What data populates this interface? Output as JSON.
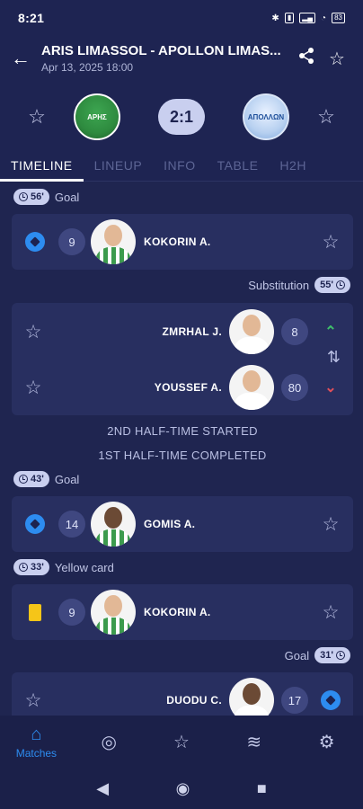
{
  "status": {
    "time": "8:21",
    "icons_text": [
      "bluetooth",
      "vibrate",
      "signal",
      "wifi",
      "battery"
    ],
    "battery": "83"
  },
  "header": {
    "title": "ARIS LIMASSOL - APOLLON LIMAS...",
    "date": "Apr 13, 2025 18:00"
  },
  "match": {
    "score": "2:1",
    "home_crest_text": "ΑΡΗΣ",
    "away_crest_text": "ΑΠΟΛΛΩΝ"
  },
  "tabs": [
    "TIMELINE",
    "LINEUP",
    "INFO",
    "TABLE",
    "H2H"
  ],
  "events": {
    "goal1": {
      "minute": "56'",
      "type": "Goal",
      "number": "9",
      "player": "KOKORIN A."
    },
    "sub": {
      "minute": "55'",
      "type": "Substitution",
      "in_number": "8",
      "in_player": "ZMRHAL J.",
      "out_number": "80",
      "out_player": "YOUSSEF A."
    },
    "second_half": "2ND HALF-TIME STARTED",
    "first_half": "1ST HALF-TIME COMPLETED",
    "goal2": {
      "minute": "43'",
      "type": "Goal",
      "number": "14",
      "player": "GOMIS A."
    },
    "yellow": {
      "minute": "33'",
      "type": "Yellow card",
      "number": "9",
      "player": "KOKORIN A."
    },
    "goal3": {
      "minute": "31'",
      "type": "Goal",
      "number": "17",
      "player": "DUODU C."
    }
  },
  "nav": {
    "matches": "Matches"
  },
  "colors": {
    "background": "#1f2550",
    "card": "#282f60",
    "accent": "#2d8cf0",
    "yellow_card": "#f5c518",
    "sub_in": "#3fbf6a",
    "sub_out": "#e0505a"
  }
}
